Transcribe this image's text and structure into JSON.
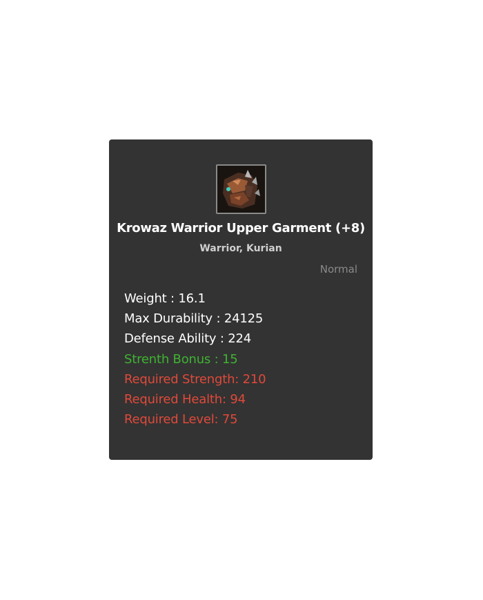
{
  "item": {
    "name": "Krowaz Warrior Upper Garment (+8)",
    "classes": "Warrior, Kurian",
    "grade": "Normal",
    "icon": "armor-chestpiece-icon"
  },
  "stats": {
    "weight": "Weight : 16.1",
    "max_durability": "Max Durability : 24125",
    "defense_ability": "Defense Ability : 224",
    "strength_bonus": "Strenth Bonus : 15"
  },
  "requirements": {
    "strength": "Required Strength: 210",
    "health": "Required Health: 94",
    "level": "Required Level: 75"
  },
  "colors": {
    "card_background": "#333333",
    "bonus": "#3fb332",
    "requirement": "#e0493a",
    "grade": "#8a8a8a"
  }
}
